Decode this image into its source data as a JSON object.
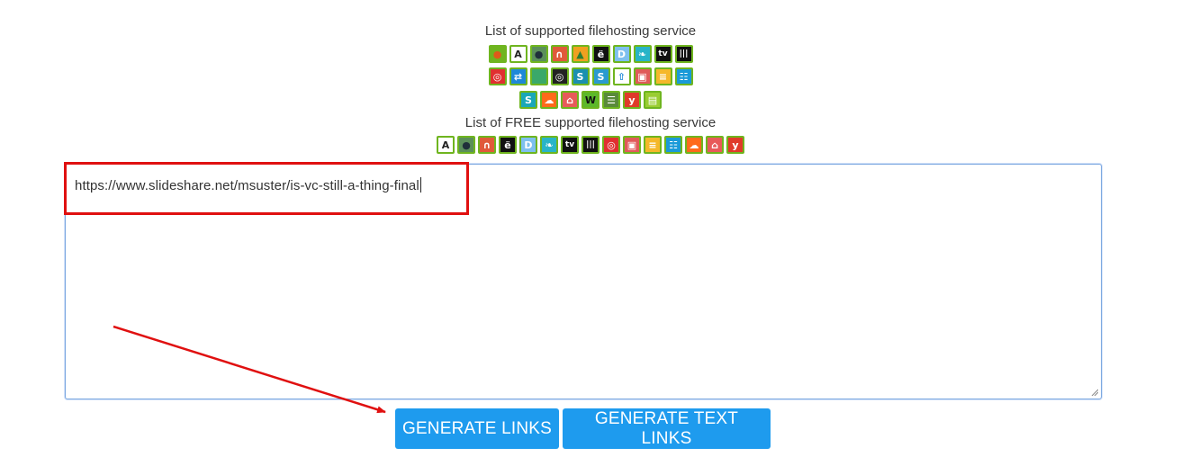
{
  "supported": {
    "heading": "List of supported filehosting service",
    "rows": [
      [
        {
          "icon": "apple-icon",
          "glyph": "●",
          "bg": "#6fb51f",
          "fg": "#e05a1a"
        },
        {
          "icon": "letter-a-icon",
          "glyph": "A",
          "bg": "#ffffff",
          "fg": "#222222"
        },
        {
          "icon": "dot-icon",
          "glyph": "●",
          "bg": "#5b8f5a",
          "fg": "#1f2f3a"
        },
        {
          "icon": "arch-icon",
          "glyph": "∩",
          "bg": "#e05a3a",
          "fg": "#ffffff"
        },
        {
          "icon": "mountain-icon",
          "glyph": "▲",
          "bg": "#f0a020",
          "fg": "#2e7d32"
        },
        {
          "icon": "letter-e-icon",
          "glyph": "ë",
          "bg": "#111111",
          "fg": "#ffffff"
        },
        {
          "icon": "letter-d-icon",
          "glyph": "D",
          "bg": "#7ec0ee",
          "fg": "#ffffff"
        },
        {
          "icon": "leaf-icon",
          "glyph": "❧",
          "bg": "#28b4c8",
          "fg": "#ffffff"
        },
        {
          "icon": "apple-tv-icon",
          "glyph": "tv",
          "bg": "#111111",
          "fg": "#ffffff"
        },
        {
          "icon": "audio-bars-icon",
          "glyph": "|||",
          "bg": "#111111",
          "fg": "#ffffff"
        }
      ],
      [
        {
          "icon": "target-icon",
          "glyph": "◎",
          "bg": "#e03030",
          "fg": "#ffffff"
        },
        {
          "icon": "link-icon",
          "glyph": "⇄",
          "bg": "#1e88d8",
          "fg": "#ffffff"
        },
        {
          "icon": "green-square-icon",
          "glyph": "",
          "bg": "#3aa86a",
          "fg": "#ffffff"
        },
        {
          "icon": "search-circle-icon",
          "glyph": "◎",
          "bg": "#222222",
          "fg": "#ffffff"
        },
        {
          "icon": "letter-s-icon",
          "glyph": "S",
          "bg": "#1a8fb0",
          "fg": "#ffffff"
        },
        {
          "icon": "letter-s-icon",
          "glyph": "S",
          "bg": "#2a9ad0",
          "fg": "#ffffff"
        },
        {
          "icon": "upload-arrow-icon",
          "glyph": "⇧",
          "bg": "#ffffff",
          "fg": "#1e88d8"
        },
        {
          "icon": "window-icon",
          "glyph": "▣",
          "bg": "#e05a5a",
          "fg": "#ffffff"
        },
        {
          "icon": "slides-icon",
          "glyph": "≡",
          "bg": "#f5b82a",
          "fg": "#ffffff"
        },
        {
          "icon": "slideshare-icon",
          "glyph": "☷",
          "bg": "#1a9ad8",
          "fg": "#ffffff"
        }
      ],
      [
        {
          "icon": "scribd-icon",
          "glyph": "S",
          "bg": "#1aa7b8",
          "fg": "#ffffff"
        },
        {
          "icon": "soundcloud-icon",
          "glyph": "☁",
          "bg": "#ff6a1a",
          "fg": "#ffffff"
        },
        {
          "icon": "storefront-icon",
          "glyph": "⌂",
          "bg": "#e85a5a",
          "fg": "#ffffff"
        },
        {
          "icon": "letter-w-icon",
          "glyph": "W",
          "bg": "#5cb82a",
          "fg": "#111111"
        },
        {
          "icon": "document-icon",
          "glyph": "☰",
          "bg": "#5a8a3a",
          "fg": "#ffffff"
        },
        {
          "icon": "letter-y-icon",
          "glyph": "y",
          "bg": "#e03a2a",
          "fg": "#ffffff"
        },
        {
          "icon": "folder-icon",
          "glyph": "▤",
          "bg": "#9acd32",
          "fg": "#ffffff"
        }
      ]
    ]
  },
  "free": {
    "heading": "List of FREE supported filehosting service",
    "icons": [
      {
        "icon": "letter-a-icon",
        "glyph": "A",
        "bg": "#ffffff",
        "fg": "#222222"
      },
      {
        "icon": "dot-icon",
        "glyph": "●",
        "bg": "#5b8f5a",
        "fg": "#1f2f3a"
      },
      {
        "icon": "arch-icon",
        "glyph": "∩",
        "bg": "#e05a3a",
        "fg": "#ffffff"
      },
      {
        "icon": "letter-e-icon",
        "glyph": "ë",
        "bg": "#111111",
        "fg": "#ffffff"
      },
      {
        "icon": "letter-d-icon",
        "glyph": "D",
        "bg": "#7ec0ee",
        "fg": "#ffffff"
      },
      {
        "icon": "leaf-icon",
        "glyph": "❧",
        "bg": "#28b4c8",
        "fg": "#ffffff"
      },
      {
        "icon": "apple-tv-icon",
        "glyph": "tv",
        "bg": "#111111",
        "fg": "#ffffff"
      },
      {
        "icon": "audio-bars-icon",
        "glyph": "|||",
        "bg": "#111111",
        "fg": "#ffffff"
      },
      {
        "icon": "target-icon",
        "glyph": "◎",
        "bg": "#e03030",
        "fg": "#ffffff"
      },
      {
        "icon": "window-icon",
        "glyph": "▣",
        "bg": "#e05a5a",
        "fg": "#ffffff"
      },
      {
        "icon": "slides-icon",
        "glyph": "≡",
        "bg": "#f5b82a",
        "fg": "#ffffff"
      },
      {
        "icon": "slideshare-icon",
        "glyph": "☷",
        "bg": "#1a9ad8",
        "fg": "#ffffff"
      },
      {
        "icon": "soundcloud-icon",
        "glyph": "☁",
        "bg": "#ff6a1a",
        "fg": "#ffffff"
      },
      {
        "icon": "storefront-icon",
        "glyph": "⌂",
        "bg": "#e85a5a",
        "fg": "#ffffff"
      },
      {
        "icon": "letter-y-icon",
        "glyph": "y",
        "bg": "#e03a2a",
        "fg": "#ffffff"
      }
    ]
  },
  "links_input": {
    "value": "https://www.slideshare.net/msuster/is-vc-still-a-thing-final"
  },
  "buttons": {
    "generate_links": "GENERATE LINKS",
    "generate_text_links": "GENERATE TEXT LINKS"
  },
  "colors": {
    "button_bg": "#1e9bee",
    "icon_border": "#6fb51f",
    "annotation_red": "#e01010"
  }
}
